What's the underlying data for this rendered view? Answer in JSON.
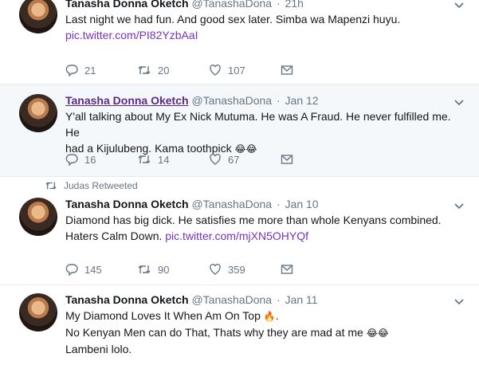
{
  "tweets": [
    {
      "name": "Tanasha Donna Oketch",
      "handle": "@TanashaDona",
      "time": "21h",
      "text": "Last night we had fun. And good sex later. Simba wa Mapenzi huyu.",
      "link": "pic.twitter.com/PI82YzbAaI",
      "replies": "21",
      "retweets": "20",
      "likes": "107"
    },
    {
      "name": "Tanasha Donna Oketch",
      "handle": "@TanashaDona",
      "time": "Jan 12",
      "text_line1": "Y'all talking about My Ex Nick Mutuma. He was A Fraud. He never fulfilled me. He",
      "text_line2": "had a Kijulubeng. Kama toothpick",
      "emoji": "😂😂",
      "replies": "16",
      "retweets": "14",
      "likes": "67"
    },
    {
      "retweeted_by": "Judas Retweeted",
      "name": "Tanasha Donna Oketch",
      "handle": "@TanashaDona",
      "time": "Jan 10",
      "text_line1": "Diamond has big dick. He satisfies me more than whole Kenyans combined.",
      "text_line2": "Haters Calm Down.",
      "link": "pic.twitter.com/mjXN5OHYQf",
      "replies": "145",
      "retweets": "90",
      "likes": "359"
    },
    {
      "name": "Tanasha Donna Oketch",
      "handle": "@TanashaDona",
      "time": "Jan 11",
      "text_line1": "My Diamond Loves It When Am On Top",
      "fire": "🔥",
      "text_line2": "No Kenyan Men can do That, Thats why they are mad at me",
      "emoji": "😂😂",
      "text_line3": "Lambeni lolo."
    }
  ],
  "separator": "·"
}
